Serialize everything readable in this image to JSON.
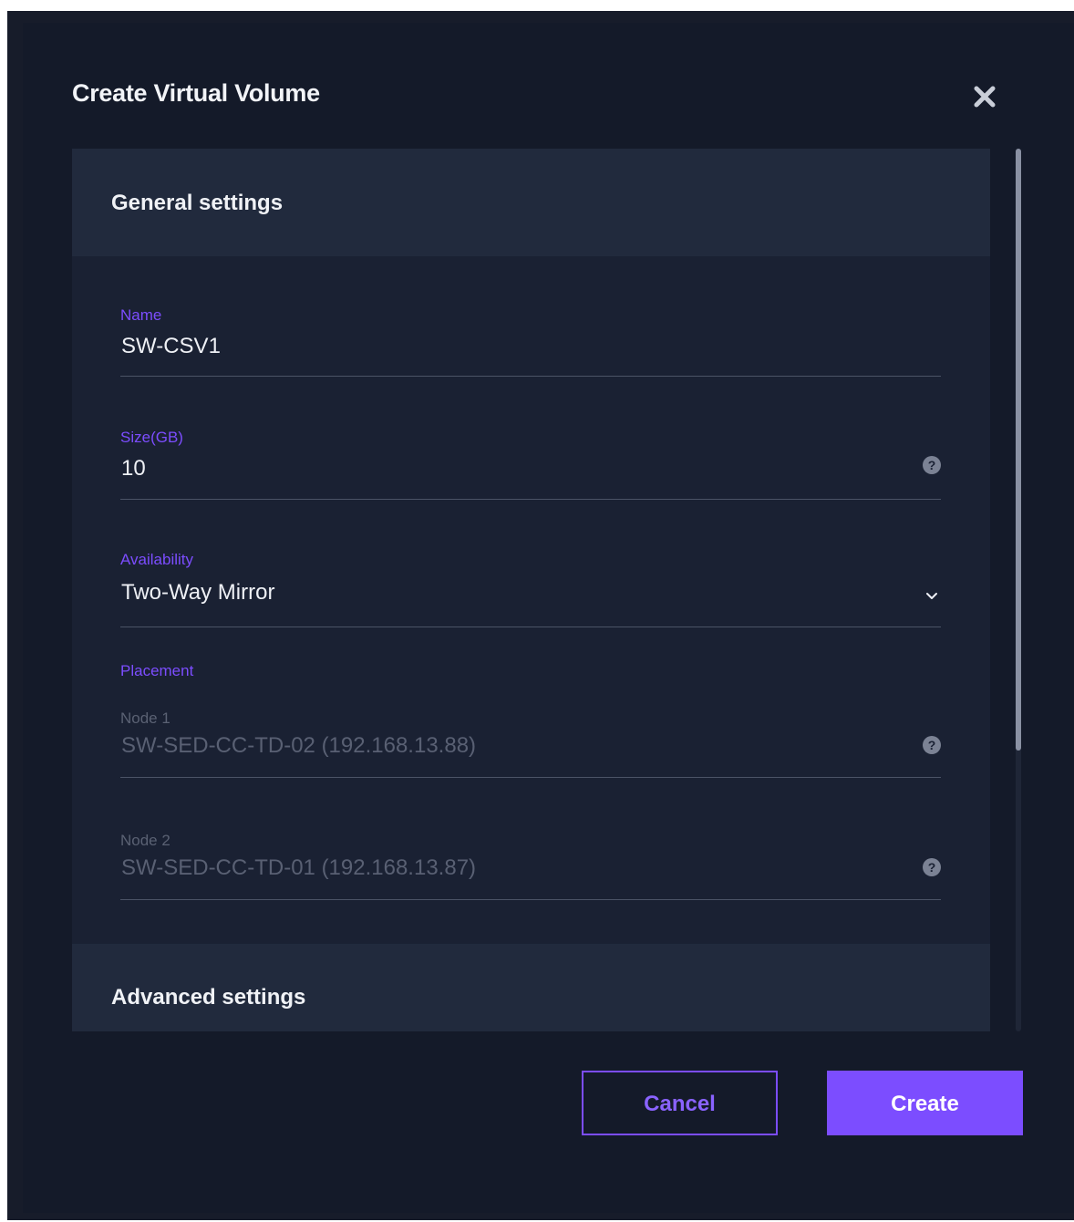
{
  "dialog": {
    "title": "Create Virtual Volume",
    "close_icon": "close-icon"
  },
  "general_settings": {
    "title": "General settings",
    "fields": {
      "name": {
        "label": "Name",
        "value": "SW-CSV1"
      },
      "size": {
        "label": "Size(GB)",
        "value": "10",
        "help_icon": "question-circle-icon"
      },
      "availability": {
        "label": "Availability",
        "value": "Two-Way Mirror",
        "dropdown_icon": "chevron-down-icon"
      }
    },
    "placement": {
      "label": "Placement",
      "node1": {
        "label": "Node 1",
        "value": "SW-SED-CC-TD-02 (192.168.13.88)",
        "help_icon": "question-circle-icon"
      },
      "node2": {
        "label": "Node 2",
        "value": "SW-SED-CC-TD-01 (192.168.13.87)",
        "help_icon": "question-circle-icon"
      }
    }
  },
  "advanced_settings": {
    "title": "Advanced settings"
  },
  "buttons": {
    "cancel": "Cancel",
    "create": "Create"
  },
  "colors": {
    "accent": "#7c4dff",
    "dialog_background": "#141a29",
    "section_header": "#212a3d",
    "section_body": "#1a2133"
  }
}
